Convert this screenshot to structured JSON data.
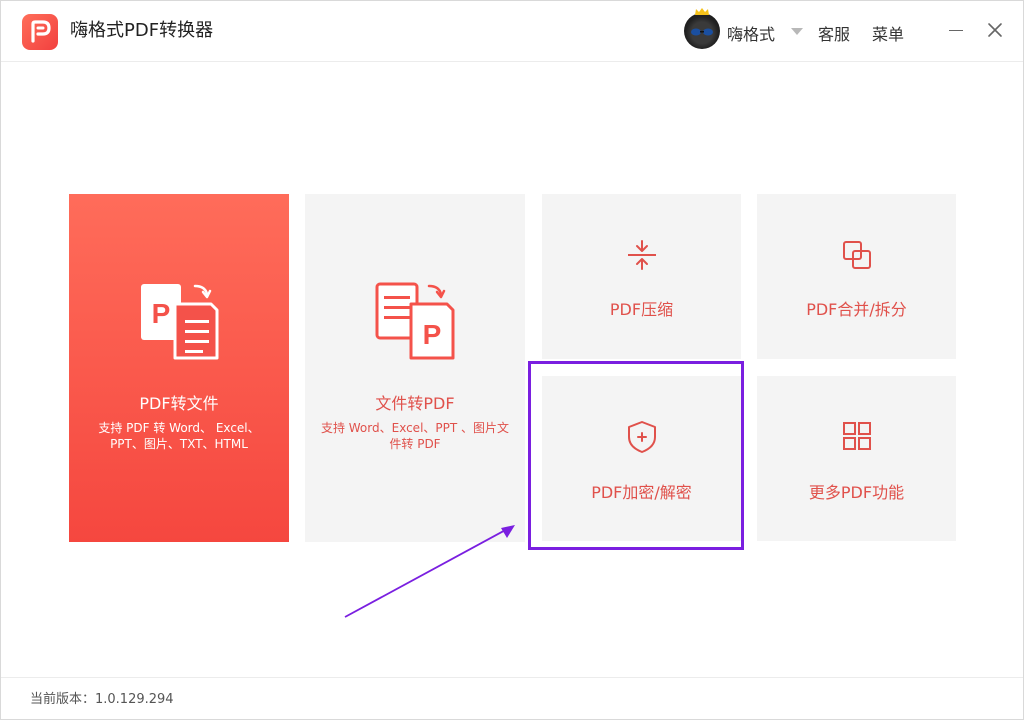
{
  "app": {
    "title": "嗨格式PDF转换器",
    "logo_icon": "pdf-logo-icon",
    "accent_color": "#f24f45"
  },
  "header": {
    "username": "嗨格式",
    "avatar_icon": "user-avatar",
    "service_label": "客服",
    "menu_label": "菜单",
    "minimize_icon": "minimize-icon",
    "close_icon": "close-icon"
  },
  "cards": {
    "pdf_to_file": {
      "label": "PDF转文件",
      "desc": "支持 PDF 转 Word、 Excel、PPT、图片、TXT、HTML",
      "icon": "pdf-to-file-icon"
    },
    "file_to_pdf": {
      "label": "文件转PDF",
      "desc": "支持 Word、Excel、PPT 、图片文件转 PDF",
      "icon": "file-to-pdf-icon"
    },
    "compress": {
      "label": "PDF压缩",
      "icon": "compress-icon"
    },
    "merge_split": {
      "label": "PDF合并/拆分",
      "icon": "merge-icon"
    },
    "encrypt": {
      "label": "PDF加密/解密",
      "icon": "shield-icon"
    },
    "more": {
      "label": "更多PDF功能",
      "icon": "grid-icon"
    }
  },
  "annotation": {
    "highlight_color": "#7a1fe0"
  },
  "footer": {
    "version_label": "当前版本：1.0.129.294"
  }
}
